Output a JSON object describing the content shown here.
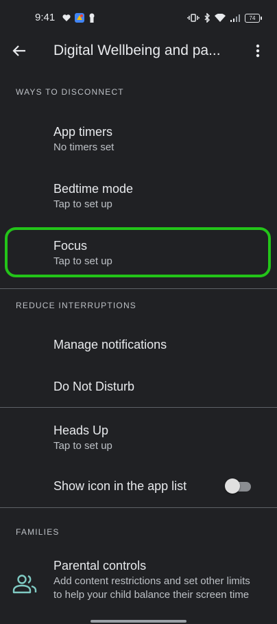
{
  "status_bar": {
    "time": "9:41",
    "battery_level": "74",
    "left_icons": [
      "heart-icon",
      "app-notification-icon",
      "keyhole-icon"
    ],
    "right_icons": [
      "vibrate-icon",
      "bluetooth-icon",
      "wifi-icon",
      "signal-icon",
      "battery-icon"
    ]
  },
  "app_bar": {
    "title": "Digital Wellbeing and pa...",
    "back_icon": "arrow-back-icon",
    "menu_icon": "more-vert-icon"
  },
  "sections": {
    "ways_to_disconnect": {
      "header": "WAYS TO DISCONNECT",
      "items": [
        {
          "title": "App timers",
          "subtitle": "No timers set"
        },
        {
          "title": "Bedtime mode",
          "subtitle": "Tap to set up"
        },
        {
          "title": "Focus",
          "subtitle": "Tap to set up"
        }
      ]
    },
    "reduce_interruptions": {
      "header": "REDUCE INTERRUPTIONS",
      "items": [
        {
          "title": "Manage notifications"
        },
        {
          "title": "Do Not Disturb"
        }
      ]
    },
    "other": {
      "items": [
        {
          "title": "Heads Up",
          "subtitle": "Tap to set up"
        },
        {
          "title": "Show icon in the app list",
          "toggle_on": false
        }
      ]
    },
    "families": {
      "header": "FAMILIES",
      "items": [
        {
          "title": "Parental controls",
          "subtitle": "Add content restrictions and set other limits to help your child balance their screen time",
          "icon": "family-icon"
        }
      ]
    }
  },
  "colors": {
    "background": "#202124",
    "highlight": "#23c419",
    "accent_icon": "#80cbc4"
  }
}
